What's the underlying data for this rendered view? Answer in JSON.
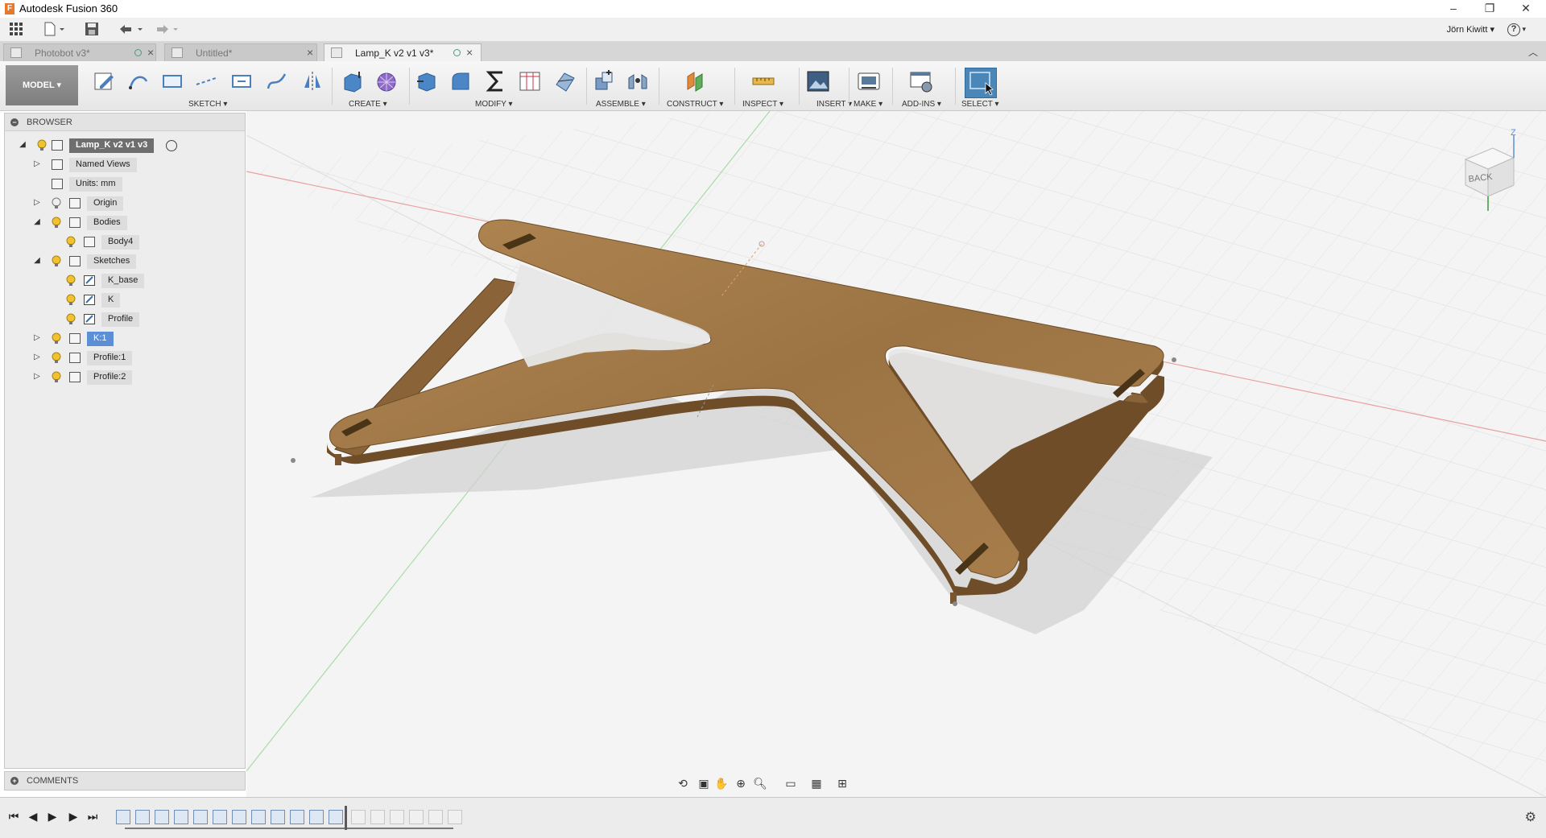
{
  "window": {
    "title": "Autodesk Fusion 360",
    "app_icon_letter": "F",
    "controls": {
      "minimize": "–",
      "restore": "❐",
      "close": "✕"
    }
  },
  "quick_access": {
    "user": "Jörn Kiwitt ▾",
    "help": "?"
  },
  "tabs": [
    {
      "label": "Photobot v3*",
      "active": false
    },
    {
      "label": "Untitled*",
      "active": false
    },
    {
      "label": "Lamp_K v2 v1 v3*",
      "active": true
    }
  ],
  "toolbar": {
    "workspace": "MODEL ▾",
    "groups": {
      "sketch": "SKETCH ▾",
      "create": "CREATE ▾",
      "modify": "MODIFY ▾",
      "assemble": "ASSEMBLE ▾",
      "construct": "CONSTRUCT ▾",
      "inspect": "INSPECT ▾",
      "insert": "INSERT ▾",
      "make": "MAKE ▾",
      "addins": "ADD-INS ▾",
      "select": "SELECT ▾"
    }
  },
  "browser": {
    "header": "BROWSER",
    "root": "Lamp_K v2 v1 v3",
    "nodes": {
      "named_views": "Named Views",
      "units": "Units: mm",
      "origin": "Origin",
      "bodies": "Bodies",
      "body4": "Body4",
      "sketches": "Sketches",
      "k_base": "K_base",
      "k": "K",
      "profile": "Profile",
      "k1": "K:1",
      "profile1": "Profile:1",
      "profile2": "Profile:2"
    }
  },
  "comments": {
    "label": "COMMENTS"
  },
  "viewcube": {
    "face": "BACK",
    "axis_z": "Z"
  },
  "colors": {
    "wood": "#a67c4a",
    "wood_dark": "#7a5630",
    "grid": "#dddddd",
    "axis_red": "#e08080",
    "axis_green": "#8fd08f",
    "selection_blue": "#5c8fd6"
  }
}
